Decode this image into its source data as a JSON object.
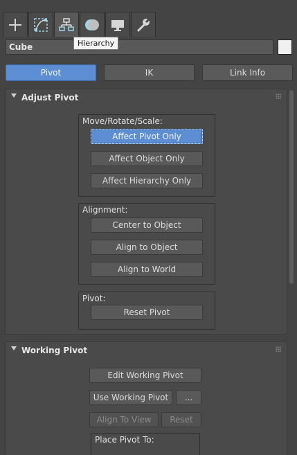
{
  "command_panel": {
    "tabs": [
      {
        "icon": "plus-icon",
        "label": "Create"
      },
      {
        "icon": "curve-icon",
        "label": "Modify"
      },
      {
        "icon": "hierarchy-icon",
        "label": "Hierarchy"
      },
      {
        "icon": "sphere-icon",
        "label": "Motion"
      },
      {
        "icon": "monitor-icon",
        "label": "Display"
      },
      {
        "icon": "wrench-icon",
        "label": "Utilities"
      }
    ],
    "tooltip": "Hierarchy",
    "object_name": "Cube",
    "object_color": "#f0f0f0",
    "accent_color": "#5d8ed4"
  },
  "subtabs": {
    "pivot": "Pivot",
    "ik": "IK",
    "link_info": "Link Info"
  },
  "adjust_pivot": {
    "title": "Adjust Pivot",
    "move_rotate_scale": {
      "label": "Move/Rotate/Scale:",
      "affect_pivot_only": "Affect Pivot Only",
      "affect_object_only": "Affect Object Only",
      "affect_hierarchy_only": "Affect Hierarchy Only"
    },
    "alignment": {
      "label": "Alignment:",
      "center_to_object": "Center to Object",
      "align_to_object": "Align to Object",
      "align_to_world": "Align to World"
    },
    "pivot": {
      "label": "Pivot:",
      "reset_pivot": "Reset Pivot"
    }
  },
  "working_pivot": {
    "title": "Working Pivot",
    "edit_working_pivot": "Edit Working Pivot",
    "use_working_pivot": "Use Working Pivot",
    "more": "...",
    "align_to_view": "Align To View",
    "reset": "Reset",
    "place_pivot_to": "Place Pivot To:"
  }
}
